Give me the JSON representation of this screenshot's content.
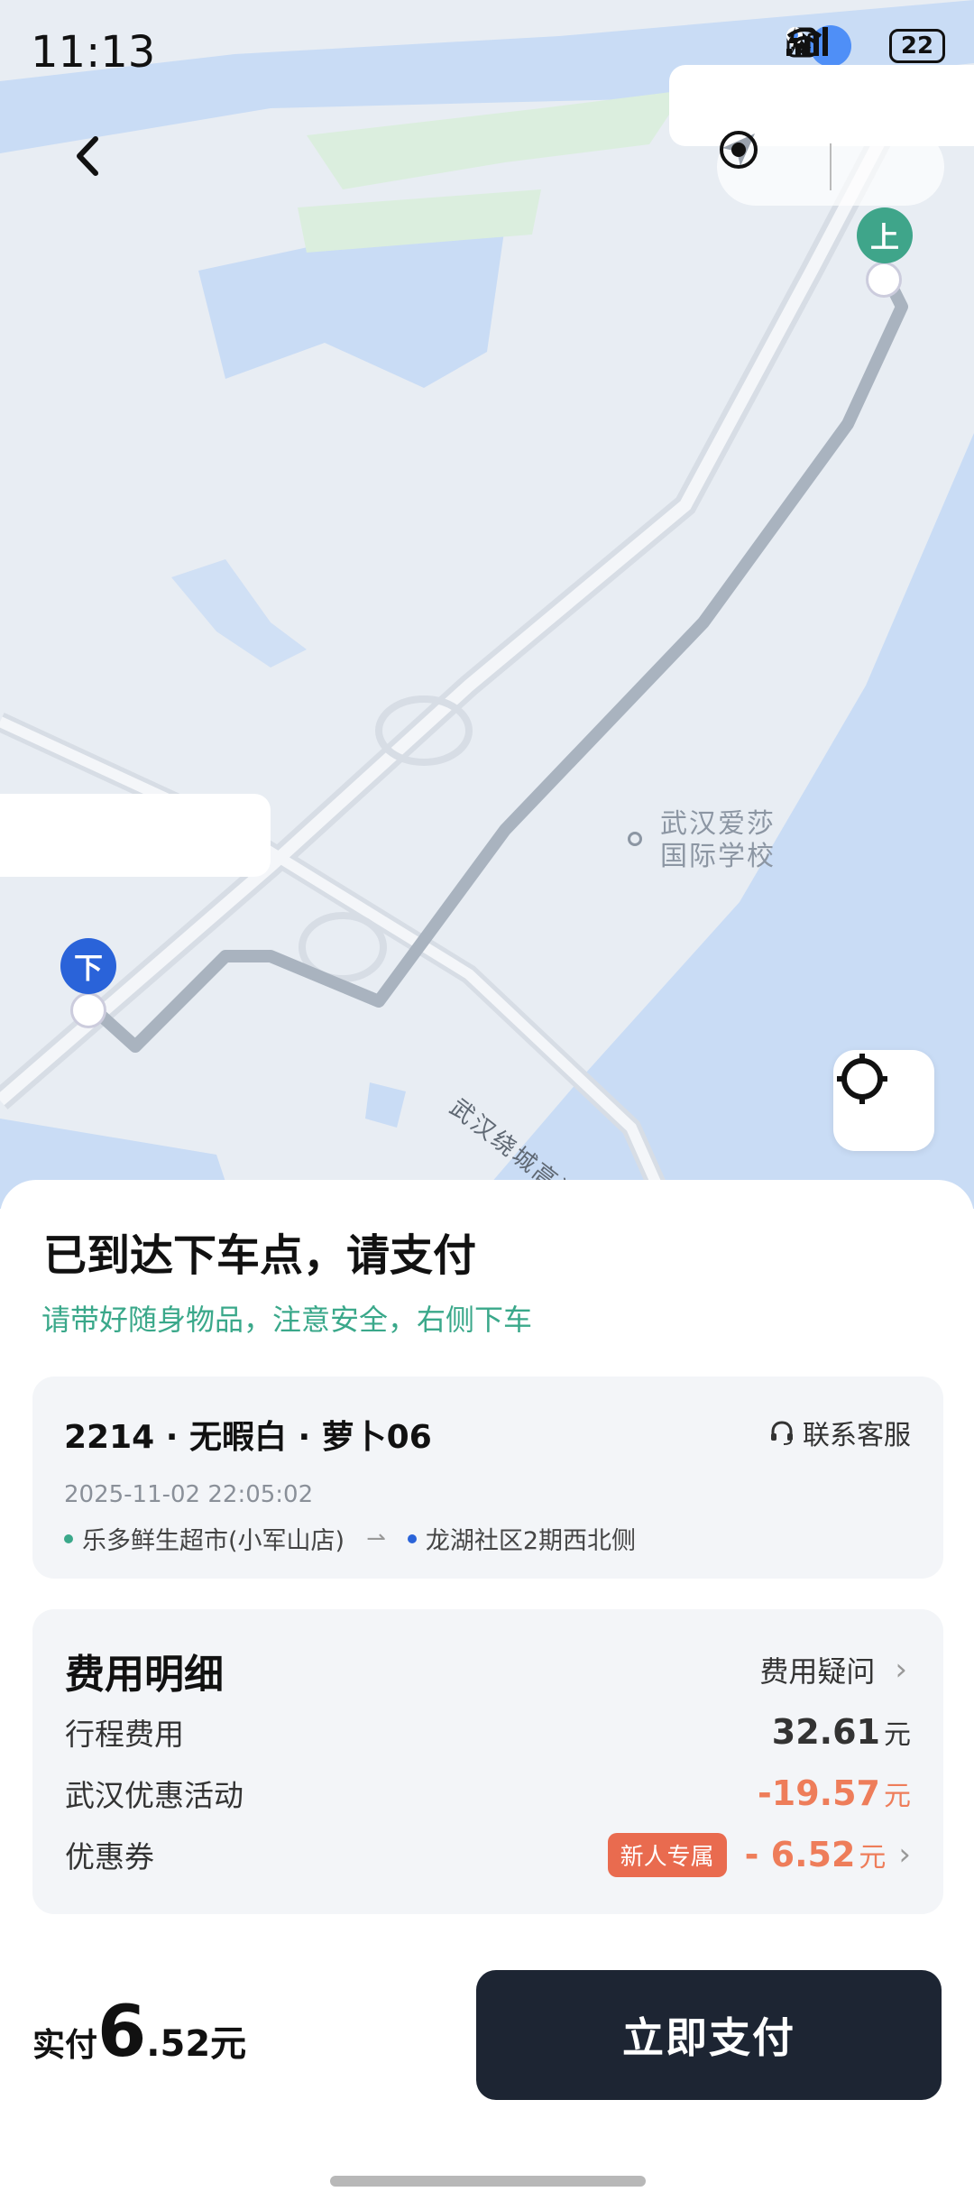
{
  "status_bar": {
    "time": "11:13",
    "battery": "22",
    "icons": [
      "nfc-icon",
      "bluetooth-icon",
      "location-icon",
      "wifi-icon",
      "signal-icon",
      "battery-icon",
      "charging-icon"
    ]
  },
  "map": {
    "pickup_pin": "上",
    "dropoff_pin": "下",
    "poi_label_line1": "武汉爱莎",
    "poi_label_line2": "国际学校",
    "road_label": "武汉绕城高速",
    "colors": {
      "land": "#e8edf3",
      "water": "#c9dcf5",
      "green": "#dbeede",
      "route": "#a9b3bf"
    }
  },
  "sheet": {
    "title": "已到达下车点，请支付",
    "subtitle": "请带好随身物品，注意安全，右侧下车",
    "trip": {
      "car": "2214 · 无暇白 · 萝卜06",
      "service": "联系客服",
      "date": "2025-11-02 22:05:02",
      "from": "乐多鲜生超市(小军山店)",
      "to": "龙湖社区2期西北侧"
    },
    "fee": {
      "heading": "费用明细",
      "question": "费用疑问",
      "rows": [
        {
          "label": "行程费用",
          "amount": "32.61",
          "unit": "元"
        },
        {
          "label": "武汉优惠活动",
          "amount": "-19.57",
          "unit": "元"
        },
        {
          "label": "优惠券",
          "badge": "新人专属",
          "amount": "- 6.52",
          "unit": "元"
        }
      ]
    },
    "paid": {
      "label": "实付",
      "big": "6",
      "rest": ".52元"
    },
    "pay_button": "立即支付"
  },
  "colors": {
    "accent_green": "#3aa88a",
    "accent_orange": "#ee7d5a",
    "button": "#1d2533"
  }
}
